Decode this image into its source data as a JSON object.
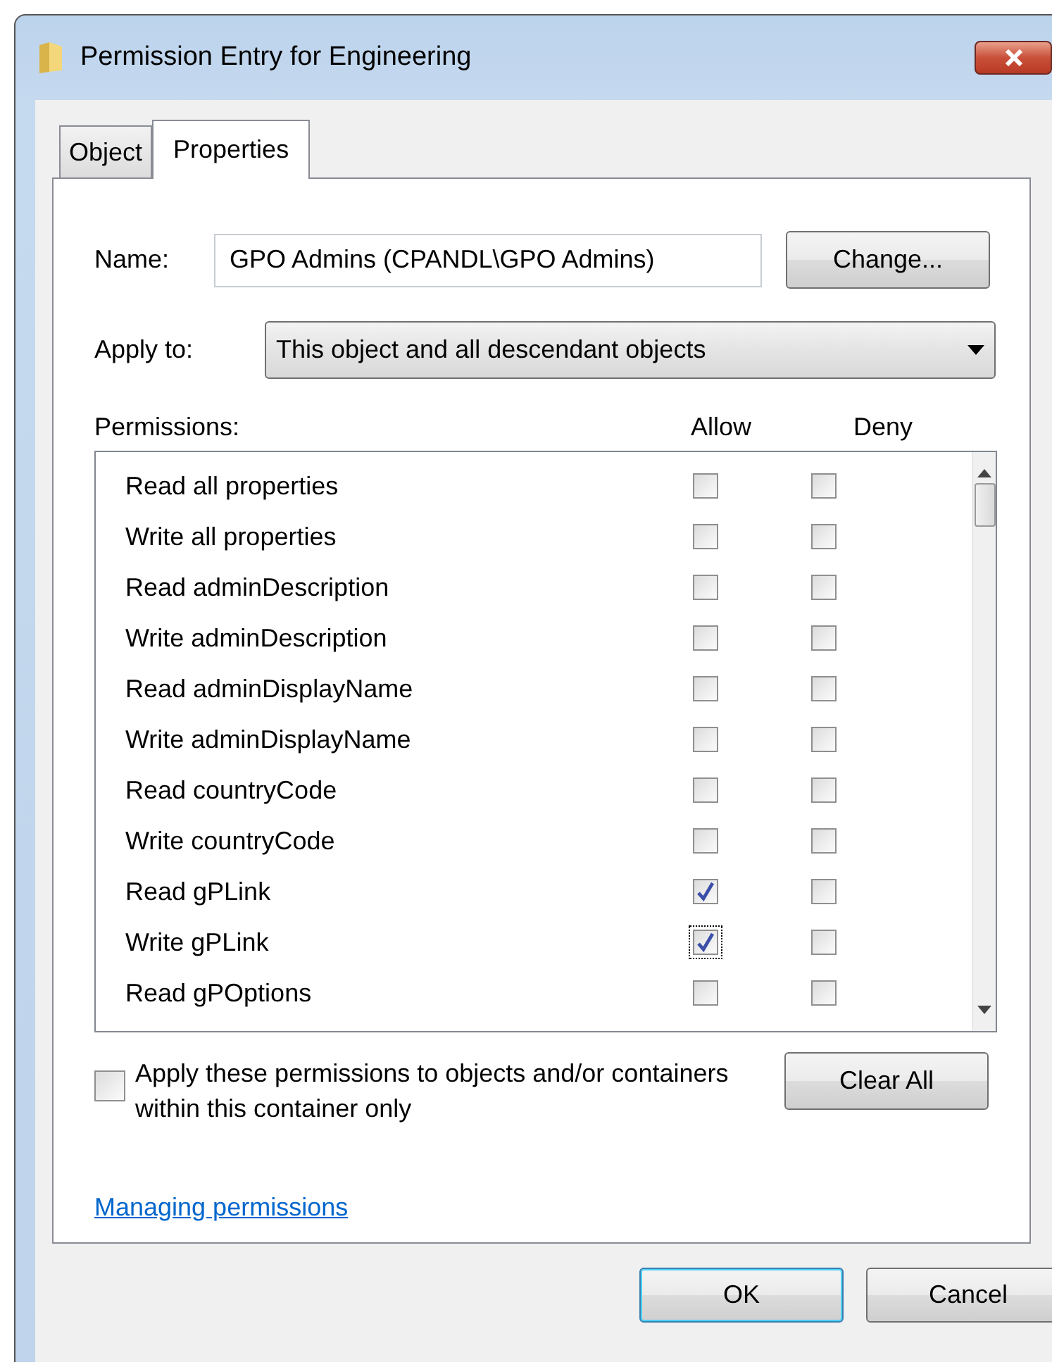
{
  "window": {
    "title": "Permission Entry for Engineering"
  },
  "tabs": [
    {
      "label": "Object",
      "selected": false
    },
    {
      "label": "Properties",
      "selected": true
    }
  ],
  "name": {
    "label": "Name:",
    "value": "GPO Admins (CPANDL\\GPO Admins)",
    "button": "Change..."
  },
  "apply_to": {
    "label": "Apply to:",
    "value": "This object and all descendant objects"
  },
  "permissions": {
    "label": "Permissions:",
    "columns": [
      "Allow",
      "Deny"
    ],
    "rows": [
      {
        "label": "Read all properties",
        "allow": false,
        "deny": false,
        "focused": false
      },
      {
        "label": "Write all properties",
        "allow": false,
        "deny": false,
        "focused": false
      },
      {
        "label": "Read adminDescription",
        "allow": false,
        "deny": false,
        "focused": false
      },
      {
        "label": "Write adminDescription",
        "allow": false,
        "deny": false,
        "focused": false
      },
      {
        "label": "Read adminDisplayName",
        "allow": false,
        "deny": false,
        "focused": false
      },
      {
        "label": "Write adminDisplayName",
        "allow": false,
        "deny": false,
        "focused": false
      },
      {
        "label": "Read countryCode",
        "allow": false,
        "deny": false,
        "focused": false
      },
      {
        "label": "Write countryCode",
        "allow": false,
        "deny": false,
        "focused": false
      },
      {
        "label": "Read gPLink",
        "allow": true,
        "deny": false,
        "focused": false
      },
      {
        "label": "Write gPLink",
        "allow": true,
        "deny": false,
        "focused": true
      },
      {
        "label": "Read gPOptions",
        "allow": false,
        "deny": false,
        "focused": false
      }
    ]
  },
  "apply_within": {
    "label": "Apply these permissions to objects and/or containers within this container only",
    "checked": false
  },
  "clear_all": "Clear All",
  "link": "Managing permissions",
  "buttons": [
    {
      "label": "OK",
      "default": true
    },
    {
      "label": "Cancel",
      "default": false
    }
  ]
}
